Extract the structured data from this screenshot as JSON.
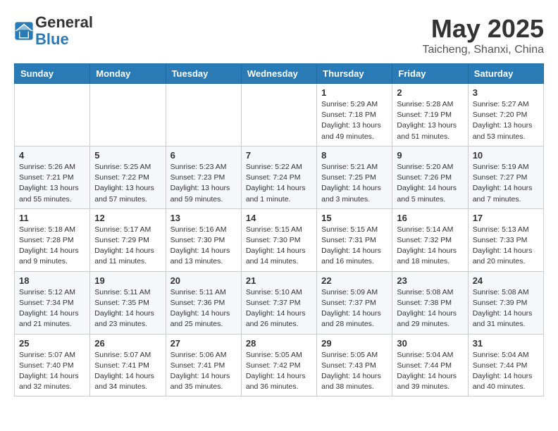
{
  "header": {
    "logo_general": "General",
    "logo_blue": "Blue",
    "month": "May 2025",
    "location": "Taicheng, Shanxi, China"
  },
  "weekdays": [
    "Sunday",
    "Monday",
    "Tuesday",
    "Wednesday",
    "Thursday",
    "Friday",
    "Saturday"
  ],
  "weeks": [
    [
      {
        "day": "",
        "info": ""
      },
      {
        "day": "",
        "info": ""
      },
      {
        "day": "",
        "info": ""
      },
      {
        "day": "",
        "info": ""
      },
      {
        "day": "1",
        "info": "Sunrise: 5:29 AM\nSunset: 7:18 PM\nDaylight: 13 hours\nand 49 minutes."
      },
      {
        "day": "2",
        "info": "Sunrise: 5:28 AM\nSunset: 7:19 PM\nDaylight: 13 hours\nand 51 minutes."
      },
      {
        "day": "3",
        "info": "Sunrise: 5:27 AM\nSunset: 7:20 PM\nDaylight: 13 hours\nand 53 minutes."
      }
    ],
    [
      {
        "day": "4",
        "info": "Sunrise: 5:26 AM\nSunset: 7:21 PM\nDaylight: 13 hours\nand 55 minutes."
      },
      {
        "day": "5",
        "info": "Sunrise: 5:25 AM\nSunset: 7:22 PM\nDaylight: 13 hours\nand 57 minutes."
      },
      {
        "day": "6",
        "info": "Sunrise: 5:23 AM\nSunset: 7:23 PM\nDaylight: 13 hours\nand 59 minutes."
      },
      {
        "day": "7",
        "info": "Sunrise: 5:22 AM\nSunset: 7:24 PM\nDaylight: 14 hours\nand 1 minute."
      },
      {
        "day": "8",
        "info": "Sunrise: 5:21 AM\nSunset: 7:25 PM\nDaylight: 14 hours\nand 3 minutes."
      },
      {
        "day": "9",
        "info": "Sunrise: 5:20 AM\nSunset: 7:26 PM\nDaylight: 14 hours\nand 5 minutes."
      },
      {
        "day": "10",
        "info": "Sunrise: 5:19 AM\nSunset: 7:27 PM\nDaylight: 14 hours\nand 7 minutes."
      }
    ],
    [
      {
        "day": "11",
        "info": "Sunrise: 5:18 AM\nSunset: 7:28 PM\nDaylight: 14 hours\nand 9 minutes."
      },
      {
        "day": "12",
        "info": "Sunrise: 5:17 AM\nSunset: 7:29 PM\nDaylight: 14 hours\nand 11 minutes."
      },
      {
        "day": "13",
        "info": "Sunrise: 5:16 AM\nSunset: 7:30 PM\nDaylight: 14 hours\nand 13 minutes."
      },
      {
        "day": "14",
        "info": "Sunrise: 5:15 AM\nSunset: 7:30 PM\nDaylight: 14 hours\nand 14 minutes."
      },
      {
        "day": "15",
        "info": "Sunrise: 5:15 AM\nSunset: 7:31 PM\nDaylight: 14 hours\nand 16 minutes."
      },
      {
        "day": "16",
        "info": "Sunrise: 5:14 AM\nSunset: 7:32 PM\nDaylight: 14 hours\nand 18 minutes."
      },
      {
        "day": "17",
        "info": "Sunrise: 5:13 AM\nSunset: 7:33 PM\nDaylight: 14 hours\nand 20 minutes."
      }
    ],
    [
      {
        "day": "18",
        "info": "Sunrise: 5:12 AM\nSunset: 7:34 PM\nDaylight: 14 hours\nand 21 minutes."
      },
      {
        "day": "19",
        "info": "Sunrise: 5:11 AM\nSunset: 7:35 PM\nDaylight: 14 hours\nand 23 minutes."
      },
      {
        "day": "20",
        "info": "Sunrise: 5:11 AM\nSunset: 7:36 PM\nDaylight: 14 hours\nand 25 minutes."
      },
      {
        "day": "21",
        "info": "Sunrise: 5:10 AM\nSunset: 7:37 PM\nDaylight: 14 hours\nand 26 minutes."
      },
      {
        "day": "22",
        "info": "Sunrise: 5:09 AM\nSunset: 7:37 PM\nDaylight: 14 hours\nand 28 minutes."
      },
      {
        "day": "23",
        "info": "Sunrise: 5:08 AM\nSunset: 7:38 PM\nDaylight: 14 hours\nand 29 minutes."
      },
      {
        "day": "24",
        "info": "Sunrise: 5:08 AM\nSunset: 7:39 PM\nDaylight: 14 hours\nand 31 minutes."
      }
    ],
    [
      {
        "day": "25",
        "info": "Sunrise: 5:07 AM\nSunset: 7:40 PM\nDaylight: 14 hours\nand 32 minutes."
      },
      {
        "day": "26",
        "info": "Sunrise: 5:07 AM\nSunset: 7:41 PM\nDaylight: 14 hours\nand 34 minutes."
      },
      {
        "day": "27",
        "info": "Sunrise: 5:06 AM\nSunset: 7:41 PM\nDaylight: 14 hours\nand 35 minutes."
      },
      {
        "day": "28",
        "info": "Sunrise: 5:05 AM\nSunset: 7:42 PM\nDaylight: 14 hours\nand 36 minutes."
      },
      {
        "day": "29",
        "info": "Sunrise: 5:05 AM\nSunset: 7:43 PM\nDaylight: 14 hours\nand 38 minutes."
      },
      {
        "day": "30",
        "info": "Sunrise: 5:04 AM\nSunset: 7:44 PM\nDaylight: 14 hours\nand 39 minutes."
      },
      {
        "day": "31",
        "info": "Sunrise: 5:04 AM\nSunset: 7:44 PM\nDaylight: 14 hours\nand 40 minutes."
      }
    ]
  ]
}
